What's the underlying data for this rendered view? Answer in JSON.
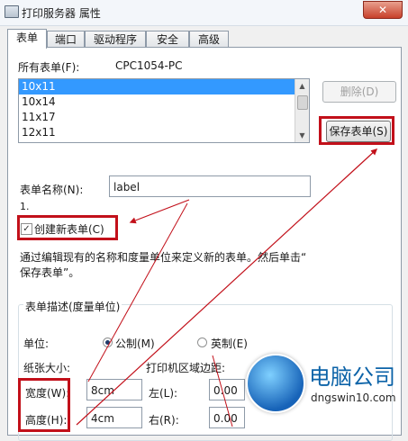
{
  "window": {
    "title": "打印服务器 属性",
    "close_label": "✕"
  },
  "tabs": [
    {
      "label": "表单",
      "active": true
    },
    {
      "label": "端口"
    },
    {
      "label": "驱动程序"
    },
    {
      "label": "安全"
    },
    {
      "label": "高级"
    }
  ],
  "forms": {
    "all_forms_label": "所有表单(F):",
    "computer_name": "CPC1054-PC",
    "list_items": [
      "10x11",
      "10x14",
      "11x17",
      "12x11"
    ],
    "selected_item": "10x11",
    "delete_button": "删除(D)",
    "save_button": "保存表单(S)",
    "form_name_label": "表单名称(N):",
    "form_name_value": "label",
    "annotation_number": "1.",
    "create_new_label": "创建新表单(C)",
    "create_new_checked": true,
    "description_line1": "通过编辑现有的名称和度量单位来定义新的表单。然后单击“",
    "description_line2": "保存表单”。"
  },
  "description_group": {
    "title": "表单描述(度量单位)",
    "units_label": "单位:",
    "metric_label": "公制(M)",
    "english_label": "英制(E)",
    "selected_unit": "metric",
    "paper_size_label": "纸张大小:",
    "printer_margins_label": "打印机区域边距:",
    "width_label": "宽度(W):",
    "width_value": "8cm",
    "height_label": "高度(H):",
    "height_value": "4cm",
    "left_label": "左(L):",
    "left_value": "0.00",
    "right_label": "右(R):",
    "right_value": "0.00"
  },
  "watermark": {
    "title": "电脑公司",
    "url": "dngswin10.com"
  },
  "colors": {
    "highlight_red": "#c2101a",
    "selection_blue": "#3399ff"
  }
}
